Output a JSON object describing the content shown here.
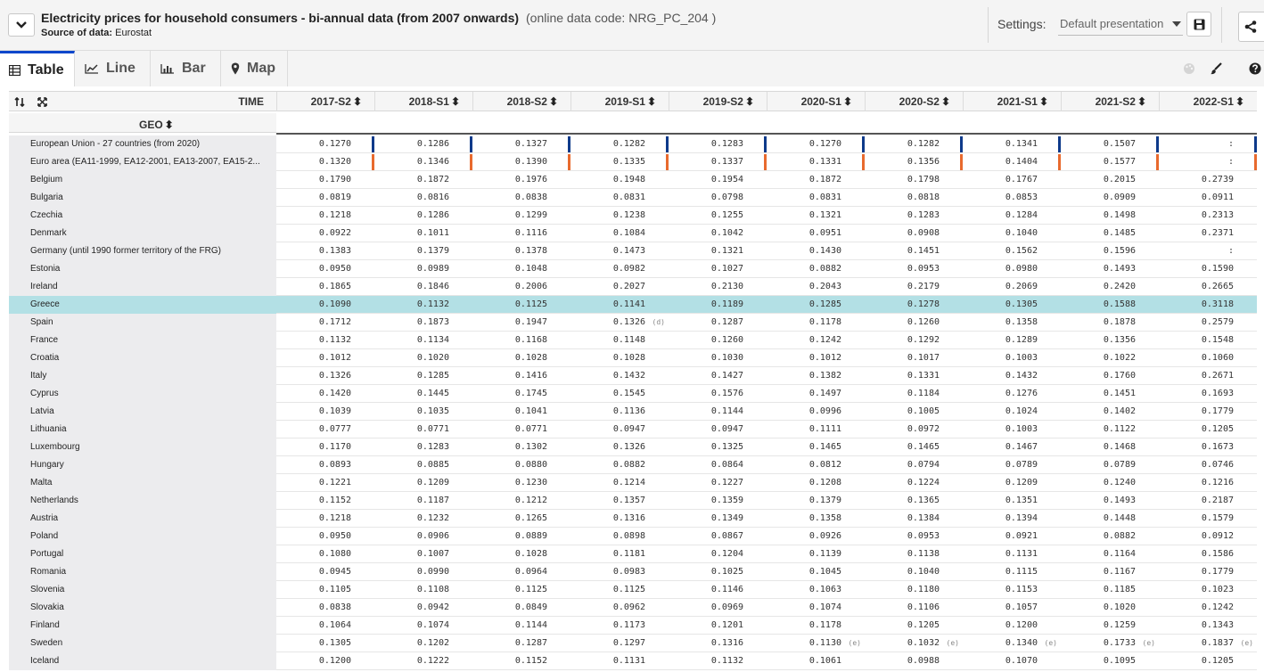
{
  "header": {
    "title": "Electricity prices for household consumers - bi-annual data (from 2007 onwards)",
    "code": "(online data code: NRG_PC_204 )",
    "source_label": "Source of data:",
    "source_value": "Eurostat",
    "settings_label": "Settings:",
    "settings_value": "Default presentation"
  },
  "tabs": [
    {
      "label": "Table",
      "icon": "table-icon"
    },
    {
      "label": "Line",
      "icon": "line-chart-icon"
    },
    {
      "label": "Bar",
      "icon": "bar-chart-icon"
    },
    {
      "label": "Map",
      "icon": "map-marker-icon"
    }
  ],
  "grid": {
    "time_label": "TIME",
    "geo_label": "GEO",
    "periods": [
      "2017-S2",
      "2018-S1",
      "2018-S2",
      "2019-S1",
      "2019-S2",
      "2020-S1",
      "2020-S2",
      "2021-S1",
      "2021-S2",
      "2022-S1"
    ],
    "rows": [
      {
        "geo": "European Union - 27 countries (from 2020)",
        "values": [
          "0.1270",
          "0.1286",
          "0.1327",
          "0.1282",
          "0.1283",
          "0.1270",
          "0.1282",
          "0.1341",
          "0.1507",
          ":"
        ],
        "flags": [
          "",
          "",
          "",
          "",
          "",
          "",
          "",
          "",
          "",
          ""
        ]
      },
      {
        "geo": "Euro area (EA11-1999, EA12-2001, EA13-2007, EA15-2...",
        "values": [
          "0.1320",
          "0.1346",
          "0.1390",
          "0.1335",
          "0.1337",
          "0.1331",
          "0.1356",
          "0.1404",
          "0.1577",
          ":"
        ],
        "flags": [
          "",
          "",
          "",
          "",
          "",
          "",
          "",
          "",
          "",
          ""
        ]
      },
      {
        "geo": "Belgium",
        "values": [
          "0.1790",
          "0.1872",
          "0.1976",
          "0.1948",
          "0.1954",
          "0.1872",
          "0.1798",
          "0.1767",
          "0.2015",
          "0.2739"
        ],
        "flags": [
          "",
          "",
          "",
          "",
          "",
          "",
          "",
          "",
          "",
          ""
        ]
      },
      {
        "geo": "Bulgaria",
        "values": [
          "0.0819",
          "0.0816",
          "0.0838",
          "0.0831",
          "0.0798",
          "0.0831",
          "0.0818",
          "0.0853",
          "0.0909",
          "0.0911"
        ],
        "flags": [
          "",
          "",
          "",
          "",
          "",
          "",
          "",
          "",
          "",
          ""
        ]
      },
      {
        "geo": "Czechia",
        "values": [
          "0.1218",
          "0.1286",
          "0.1299",
          "0.1238",
          "0.1255",
          "0.1321",
          "0.1283",
          "0.1284",
          "0.1498",
          "0.2313"
        ],
        "flags": [
          "",
          "",
          "",
          "",
          "",
          "",
          "",
          "",
          "",
          ""
        ]
      },
      {
        "geo": "Denmark",
        "values": [
          "0.0922",
          "0.1011",
          "0.1116",
          "0.1084",
          "0.1042",
          "0.0951",
          "0.0908",
          "0.1040",
          "0.1485",
          "0.2371"
        ],
        "flags": [
          "",
          "",
          "",
          "",
          "",
          "",
          "",
          "",
          "",
          ""
        ]
      },
      {
        "geo": "Germany (until 1990 former territory of the FRG)",
        "values": [
          "0.1383",
          "0.1379",
          "0.1378",
          "0.1473",
          "0.1321",
          "0.1430",
          "0.1451",
          "0.1562",
          "0.1596",
          ":"
        ],
        "flags": [
          "",
          "",
          "",
          "",
          "",
          "",
          "",
          "",
          "",
          ""
        ]
      },
      {
        "geo": "Estonia",
        "values": [
          "0.0950",
          "0.0989",
          "0.1048",
          "0.0982",
          "0.1027",
          "0.0882",
          "0.0953",
          "0.0980",
          "0.1493",
          "0.1590"
        ],
        "flags": [
          "",
          "",
          "",
          "",
          "",
          "",
          "",
          "",
          "",
          ""
        ]
      },
      {
        "geo": "Ireland",
        "values": [
          "0.1865",
          "0.1846",
          "0.2006",
          "0.2027",
          "0.2130",
          "0.2043",
          "0.2179",
          "0.2069",
          "0.2420",
          "0.2665"
        ],
        "flags": [
          "",
          "",
          "",
          "",
          "",
          "",
          "",
          "",
          "",
          ""
        ]
      },
      {
        "geo": "Greece",
        "values": [
          "0.1090",
          "0.1132",
          "0.1125",
          "0.1141",
          "0.1189",
          "0.1285",
          "0.1278",
          "0.1305",
          "0.1588",
          "0.3118"
        ],
        "flags": [
          "",
          "",
          "",
          "",
          "",
          "",
          "",
          "",
          "",
          ""
        ],
        "highlight": true
      },
      {
        "geo": "Spain",
        "values": [
          "0.1712",
          "0.1873",
          "0.1947",
          "0.1326",
          "0.1287",
          "0.1178",
          "0.1260",
          "0.1358",
          "0.1878",
          "0.2579"
        ],
        "flags": [
          "",
          "",
          "",
          "(d)",
          "",
          "",
          "",
          "",
          "",
          ""
        ]
      },
      {
        "geo": "France",
        "values": [
          "0.1132",
          "0.1134",
          "0.1168",
          "0.1148",
          "0.1260",
          "0.1242",
          "0.1292",
          "0.1289",
          "0.1356",
          "0.1548"
        ],
        "flags": [
          "",
          "",
          "",
          "",
          "",
          "",
          "",
          "",
          "",
          ""
        ]
      },
      {
        "geo": "Croatia",
        "values": [
          "0.1012",
          "0.1020",
          "0.1028",
          "0.1028",
          "0.1030",
          "0.1012",
          "0.1017",
          "0.1003",
          "0.1022",
          "0.1060"
        ],
        "flags": [
          "",
          "",
          "",
          "",
          "",
          "",
          "",
          "",
          "",
          ""
        ]
      },
      {
        "geo": "Italy",
        "values": [
          "0.1326",
          "0.1285",
          "0.1416",
          "0.1432",
          "0.1427",
          "0.1382",
          "0.1331",
          "0.1432",
          "0.1760",
          "0.2671"
        ],
        "flags": [
          "",
          "",
          "",
          "",
          "",
          "",
          "",
          "",
          "",
          ""
        ]
      },
      {
        "geo": "Cyprus",
        "values": [
          "0.1420",
          "0.1445",
          "0.1745",
          "0.1545",
          "0.1576",
          "0.1497",
          "0.1184",
          "0.1276",
          "0.1451",
          "0.1693"
        ],
        "flags": [
          "",
          "",
          "",
          "",
          "",
          "",
          "",
          "",
          "",
          ""
        ]
      },
      {
        "geo": "Latvia",
        "values": [
          "0.1039",
          "0.1035",
          "0.1041",
          "0.1136",
          "0.1144",
          "0.0996",
          "0.1005",
          "0.1024",
          "0.1402",
          "0.1779"
        ],
        "flags": [
          "",
          "",
          "",
          "",
          "",
          "",
          "",
          "",
          "",
          ""
        ]
      },
      {
        "geo": "Lithuania",
        "values": [
          "0.0777",
          "0.0771",
          "0.0771",
          "0.0947",
          "0.0947",
          "0.1111",
          "0.0972",
          "0.1003",
          "0.1122",
          "0.1205"
        ],
        "flags": [
          "",
          "",
          "",
          "",
          "",
          "",
          "",
          "",
          "",
          ""
        ]
      },
      {
        "geo": "Luxembourg",
        "values": [
          "0.1170",
          "0.1283",
          "0.1302",
          "0.1326",
          "0.1325",
          "0.1465",
          "0.1465",
          "0.1467",
          "0.1468",
          "0.1673"
        ],
        "flags": [
          "",
          "",
          "",
          "",
          "",
          "",
          "",
          "",
          "",
          ""
        ]
      },
      {
        "geo": "Hungary",
        "values": [
          "0.0893",
          "0.0885",
          "0.0880",
          "0.0882",
          "0.0864",
          "0.0812",
          "0.0794",
          "0.0789",
          "0.0789",
          "0.0746"
        ],
        "flags": [
          "",
          "",
          "",
          "",
          "",
          "",
          "",
          "",
          "",
          ""
        ]
      },
      {
        "geo": "Malta",
        "values": [
          "0.1221",
          "0.1209",
          "0.1230",
          "0.1214",
          "0.1227",
          "0.1208",
          "0.1224",
          "0.1209",
          "0.1240",
          "0.1216"
        ],
        "flags": [
          "",
          "",
          "",
          "",
          "",
          "",
          "",
          "",
          "",
          ""
        ]
      },
      {
        "geo": "Netherlands",
        "values": [
          "0.1152",
          "0.1187",
          "0.1212",
          "0.1357",
          "0.1359",
          "0.1379",
          "0.1365",
          "0.1351",
          "0.1493",
          "0.2187"
        ],
        "flags": [
          "",
          "",
          "",
          "",
          "",
          "",
          "",
          "",
          "",
          ""
        ]
      },
      {
        "geo": "Austria",
        "values": [
          "0.1218",
          "0.1232",
          "0.1265",
          "0.1316",
          "0.1349",
          "0.1358",
          "0.1384",
          "0.1394",
          "0.1448",
          "0.1579"
        ],
        "flags": [
          "",
          "",
          "",
          "",
          "",
          "",
          "",
          "",
          "",
          ""
        ]
      },
      {
        "geo": "Poland",
        "values": [
          "0.0950",
          "0.0906",
          "0.0889",
          "0.0898",
          "0.0867",
          "0.0926",
          "0.0953",
          "0.0921",
          "0.0882",
          "0.0912"
        ],
        "flags": [
          "",
          "",
          "",
          "",
          "",
          "",
          "",
          "",
          "",
          ""
        ]
      },
      {
        "geo": "Portugal",
        "values": [
          "0.1080",
          "0.1007",
          "0.1028",
          "0.1181",
          "0.1204",
          "0.1139",
          "0.1138",
          "0.1131",
          "0.1164",
          "0.1586"
        ],
        "flags": [
          "",
          "",
          "",
          "",
          "",
          "",
          "",
          "",
          "",
          ""
        ]
      },
      {
        "geo": "Romania",
        "values": [
          "0.0945",
          "0.0990",
          "0.0964",
          "0.0983",
          "0.1025",
          "0.1045",
          "0.1040",
          "0.1115",
          "0.1167",
          "0.1779"
        ],
        "flags": [
          "",
          "",
          "",
          "",
          "",
          "",
          "",
          "",
          "",
          ""
        ]
      },
      {
        "geo": "Slovenia",
        "values": [
          "0.1105",
          "0.1108",
          "0.1125",
          "0.1125",
          "0.1146",
          "0.1063",
          "0.1180",
          "0.1153",
          "0.1185",
          "0.1023"
        ],
        "flags": [
          "",
          "",
          "",
          "",
          "",
          "",
          "",
          "",
          "",
          ""
        ]
      },
      {
        "geo": "Slovakia",
        "values": [
          "0.0838",
          "0.0942",
          "0.0849",
          "0.0962",
          "0.0969",
          "0.1074",
          "0.1106",
          "0.1057",
          "0.1020",
          "0.1242"
        ],
        "flags": [
          "",
          "",
          "",
          "",
          "",
          "",
          "",
          "",
          "",
          ""
        ]
      },
      {
        "geo": "Finland",
        "values": [
          "0.1064",
          "0.1074",
          "0.1144",
          "0.1173",
          "0.1201",
          "0.1178",
          "0.1205",
          "0.1200",
          "0.1259",
          "0.1343"
        ],
        "flags": [
          "",
          "",
          "",
          "",
          "",
          "",
          "",
          "",
          "",
          ""
        ]
      },
      {
        "geo": "Sweden",
        "values": [
          "0.1305",
          "0.1202",
          "0.1287",
          "0.1297",
          "0.1316",
          "0.1130",
          "0.1032",
          "0.1340",
          "0.1733",
          "0.1837"
        ],
        "flags": [
          "",
          "",
          "",
          "",
          "",
          "(e)",
          "(e)",
          "(e)",
          "(e)",
          "(e)"
        ]
      },
      {
        "geo": "Iceland",
        "values": [
          "0.1200",
          "0.1222",
          "0.1152",
          "0.1131",
          "0.1132",
          "0.1061",
          "0.0988",
          "0.1070",
          "0.1095",
          "0.1205"
        ],
        "flags": [
          "",
          "",
          "",
          "",
          "",
          "",
          "",
          "",
          "",
          ""
        ]
      }
    ]
  },
  "colors": {
    "accent": "#0e47cb",
    "highlight_row": "#b3e0e5",
    "eu_marker": "#0e3a8a",
    "ea_marker": "#e86a2e",
    "label_column": "#ececee"
  }
}
